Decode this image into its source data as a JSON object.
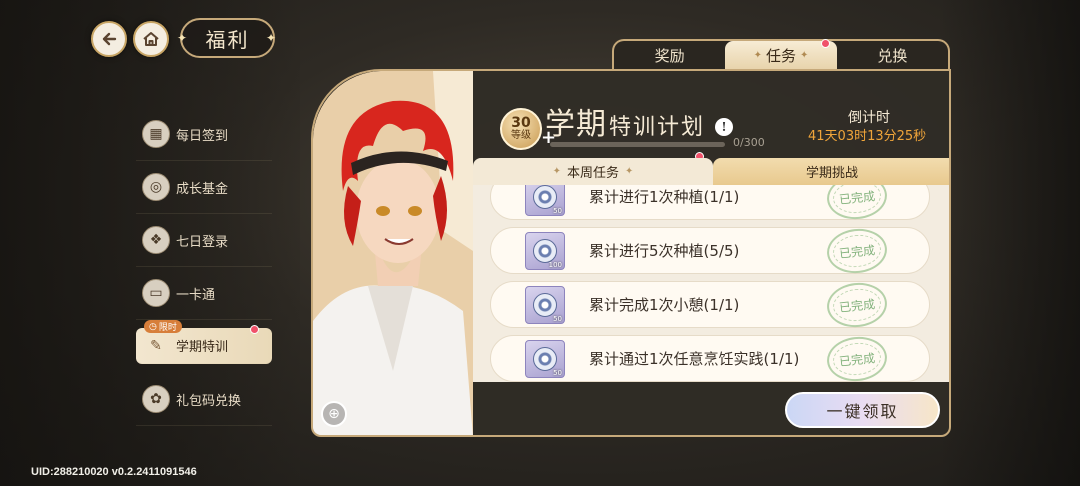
{
  "header": {
    "title": "福利"
  },
  "sidebar": {
    "items": [
      {
        "label": "每日签到",
        "icon": "calendar-icon"
      },
      {
        "label": "成长基金",
        "icon": "coins-icon"
      },
      {
        "label": "七日登录",
        "icon": "gift-box-icon"
      },
      {
        "label": "一卡通",
        "icon": "card-icon"
      },
      {
        "label": "学期特训",
        "icon": "quill-icon",
        "tag": "限时",
        "active": true
      },
      {
        "label": "礼包码兑换",
        "icon": "gift-icon"
      }
    ]
  },
  "tabs": [
    {
      "label": "奖励"
    },
    {
      "label": "任务",
      "active": true
    },
    {
      "label": "兑换"
    }
  ],
  "event": {
    "level": "30",
    "level_label": "等级",
    "title_big": "学期",
    "title_small": "特训计划",
    "progress_text": "0/300",
    "progress_fraction": 0,
    "countdown_label": "倒计时",
    "countdown_value": "41天03时13分25秒"
  },
  "subtabs": {
    "weekly": "本周任务",
    "semester": "学期挑战"
  },
  "tasks": [
    {
      "text": "累计进行1次种植(1/1)",
      "qty": "50",
      "status": "已完成"
    },
    {
      "text": "累计进行5次种植(5/5)",
      "qty": "100",
      "status": "已完成"
    },
    {
      "text": "累计完成1次小憩(1/1)",
      "qty": "50",
      "status": "已完成"
    },
    {
      "text": "累计通过1次任意烹饪实践(1/1)",
      "qty": "50",
      "status": "已完成"
    }
  ],
  "claim_all": "一键领取",
  "uid": "UID:288210020  v0.2.2411091546",
  "colors": {
    "accent_gold": "#c6a97a",
    "countdown": "#f0a53a",
    "badge_red": "#f0516a",
    "stamp_green": "#64a05f"
  }
}
